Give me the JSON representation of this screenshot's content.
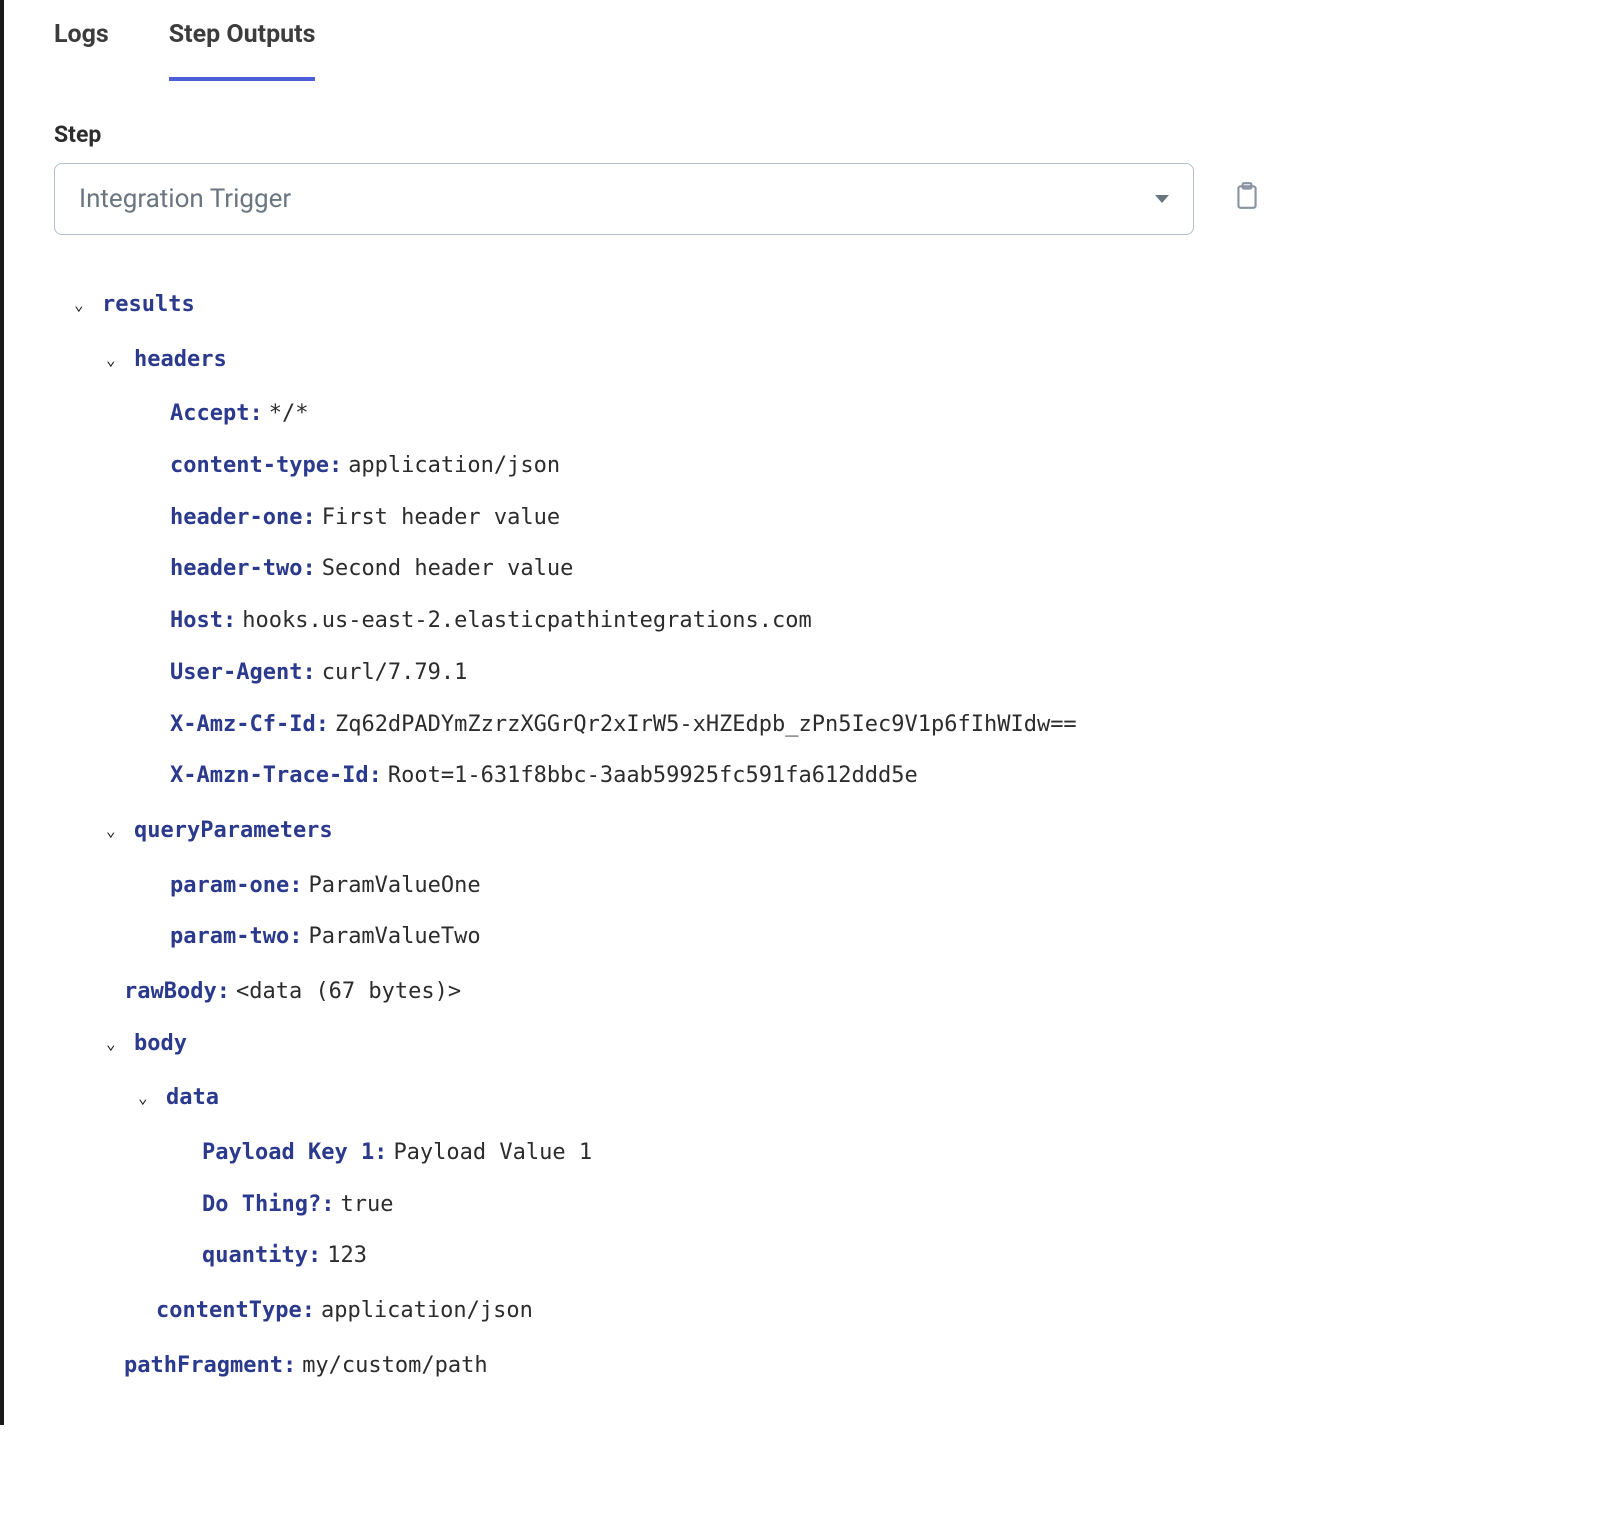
{
  "tabs": {
    "logs": "Logs",
    "step_outputs": "Step Outputs"
  },
  "step": {
    "label": "Step",
    "selected": "Integration Trigger"
  },
  "tree": {
    "results": {
      "label": "results",
      "headers": {
        "label": "headers",
        "Accept": {
          "key": "Accept:",
          "val": "*/*"
        },
        "content_type": {
          "key": "content-type:",
          "val": "application/json"
        },
        "header_one": {
          "key": "header-one:",
          "val": "First header value"
        },
        "header_two": {
          "key": "header-two:",
          "val": "Second header value"
        },
        "Host": {
          "key": "Host:",
          "val": " hooks.us-east-2.elasticpathintegrations.com"
        },
        "User_Agent": {
          "key": "User-Agent:",
          "val": "curl/7.79.1"
        },
        "X_Amz_Cf_Id": {
          "key": "X-Amz-Cf-Id:",
          "val": "Zq62dPADYmZzrzXGGrQr2xIrW5-xHZEdpb_zPn5Iec9V1p6fIhWIdw=="
        },
        "X_Amzn_Trace_Id": {
          "key": "X-Amzn-Trace-Id:",
          "val": "Root=1-631f8bbc-3aab59925fc591fa612ddd5e"
        }
      },
      "queryParameters": {
        "label": "queryParameters",
        "param_one": {
          "key": "param-one:",
          "val": "ParamValueOne"
        },
        "param_two": {
          "key": "param-two:",
          "val": "ParamValueTwo"
        }
      },
      "rawBody": {
        "key": "rawBody:",
        "val": "<data (67 bytes)>"
      },
      "body": {
        "label": "body",
        "data": {
          "label": "data",
          "payload_key_1": {
            "key": "Payload Key 1:",
            "val": "Payload Value 1"
          },
          "do_thing": {
            "key": "Do Thing?:",
            "val": "true"
          },
          "quantity": {
            "key": "quantity:",
            "val": "123"
          }
        },
        "contentType": {
          "key": "contentType:",
          "val": "application/json"
        }
      },
      "pathFragment": {
        "key": "pathFragment:",
        "val": "my/custom/path"
      }
    }
  }
}
